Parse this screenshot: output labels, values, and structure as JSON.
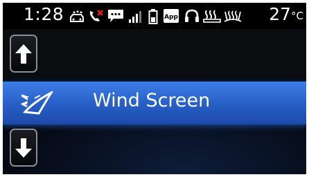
{
  "status_bar": {
    "time": "1:28",
    "temperature": "27",
    "temperature_unit": "°C",
    "icons": [
      "car-wash-icon",
      "missed-call-icon",
      "message-icon",
      "signal-strength-icon",
      "battery-icon",
      "app-icon",
      "headphones-icon",
      "rear-defrost-icon",
      "front-defrost-icon"
    ]
  },
  "menu": {
    "up_button_icon": "arrow-up-icon",
    "down_button_icon": "arrow-down-icon",
    "selected_item": {
      "label": "Wind Screen",
      "icon": "windscreen-airflow-icon"
    }
  },
  "colors": {
    "highlight": "#2a63cc",
    "background": "#0a0c10"
  }
}
